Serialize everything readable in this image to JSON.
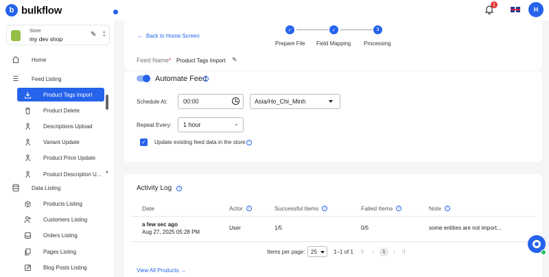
{
  "app": {
    "logo_letter": "b",
    "name": "bulkflow"
  },
  "header": {
    "notification_count": "1",
    "avatar_initial": "H"
  },
  "store": {
    "label": "Store",
    "name": "my dev shop"
  },
  "sidebar": {
    "home": "Home",
    "feed_listing": "Feed Listing",
    "feed_items": [
      "Product Tags Import",
      "Product Delete",
      "Descriptions Upload",
      "Variant Update",
      "Product Price Update",
      "Product Description U..."
    ],
    "data_listing": "Data Listing",
    "data_items": [
      "Products Listing",
      "Customers Listing",
      "Orders Listing",
      "Pages Listing",
      "Blog Posts Listing"
    ],
    "active_item": "Product Tags Import"
  },
  "top": {
    "back_label": "Back to Home Screen",
    "steps": [
      {
        "label": "Prepare File",
        "state": "done"
      },
      {
        "label": "Field Mapping",
        "state": "done"
      },
      {
        "label": "Processing",
        "number": "3",
        "state": "current"
      }
    ],
    "feed_name_label": "Feed Name",
    "feed_name_required": "*",
    "feed_name_value": "Product Tags Import"
  },
  "automate": {
    "label": "Automate Feed",
    "enabled": true,
    "schedule_label": "Schedule At:",
    "schedule_time": "00:00",
    "timezone": "Asia/Ho_Chi_Minh",
    "repeat_label": "Repeat Every:",
    "repeat_value": "1 hour",
    "update_existing_label": "Update existing feed data in the store",
    "update_existing_checked": true
  },
  "activity": {
    "title": "Activity Log",
    "columns": [
      "Date",
      "Actor",
      "Successful Items",
      "Failed Items",
      "Note"
    ],
    "rows": [
      {
        "date_relative": "a few sec ago",
        "date_full": "Aug 27, 2025 05:28 PM",
        "actor": "User",
        "successful": "1/5",
        "failed": "0/5",
        "note": "some entities are not import..."
      }
    ],
    "items_per_page_label": "Items per page:",
    "items_per_page": "25",
    "range": "1–1 of 1",
    "page": "1",
    "view_all": "View All Products"
  },
  "colors": {
    "accent": "#2563eb",
    "badge": "#e53935",
    "online": "#22c55e"
  }
}
